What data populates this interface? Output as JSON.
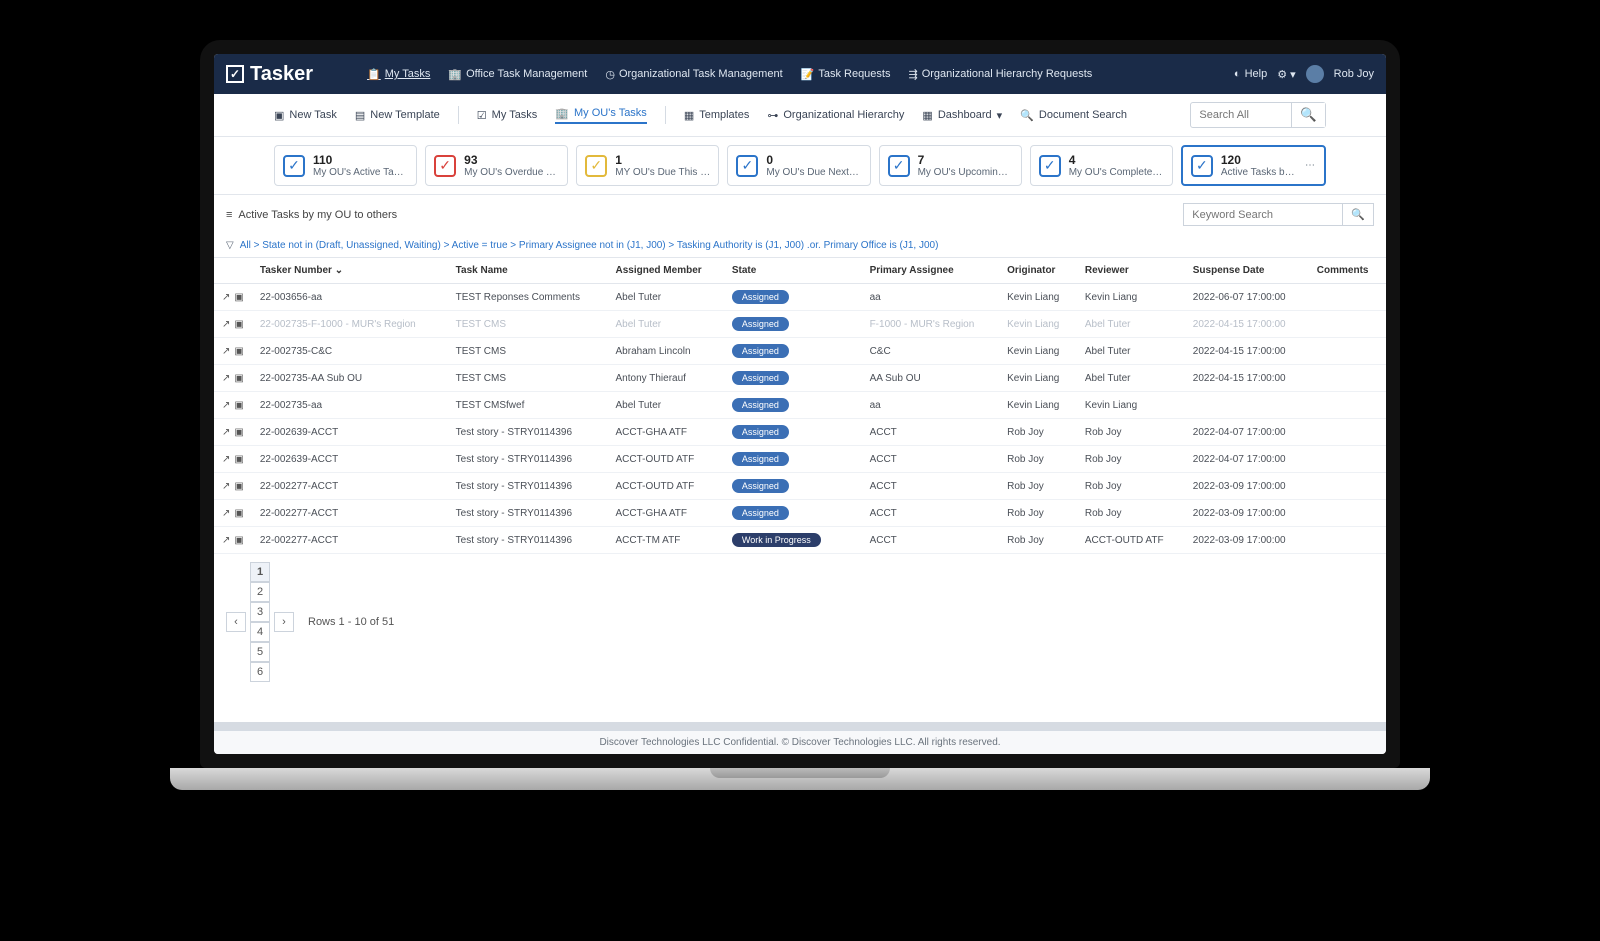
{
  "app": {
    "name": "Tasker",
    "user": "Rob Joy",
    "help_label": "Help"
  },
  "topnav": [
    {
      "label": "My Tasks",
      "active": true
    },
    {
      "label": "Office Task Management"
    },
    {
      "label": "Organizational Task Management"
    },
    {
      "label": "Task Requests"
    },
    {
      "label": "Organizational Hierarchy Requests"
    }
  ],
  "subbar": {
    "new_task": "New Task",
    "new_template": "New Template",
    "my_tasks": "My Tasks",
    "my_ous_tasks": "My OU's Tasks",
    "templates": "Templates",
    "org_hierarchy": "Organizational Hierarchy",
    "dashboard": "Dashboard",
    "doc_search": "Document Search",
    "search_placeholder": "Search All"
  },
  "stats": [
    {
      "num": "110",
      "label": "My OU's Active Tasks",
      "color": "blue"
    },
    {
      "num": "93",
      "label": "My OU's Overdue Tasks",
      "color": "red"
    },
    {
      "num": "1",
      "label": "MY OU's Due This Week",
      "color": "yellow"
    },
    {
      "num": "0",
      "label": "My OU's Due Next Week",
      "color": "blue"
    },
    {
      "num": "7",
      "label": "My OU's Upcoming Tasks",
      "color": "blue"
    },
    {
      "num": "4",
      "label": "My OU's Completed This week",
      "color": "blue"
    },
    {
      "num": "120",
      "label": "Active Tasks by my OU to others",
      "color": "blue",
      "active": true
    }
  ],
  "list": {
    "title": "Active Tasks by my OU to others",
    "filter_text": "All > State not in (Draft, Unassigned, Waiting) > Active = true > Primary Assignee not in (J1, J00) > Tasking Authority is (J1, J00) .or. Primary Office is (J1, J00)",
    "keyword_placeholder": "Keyword Search",
    "columns": [
      "Tasker Number",
      "Task Name",
      "Assigned Member",
      "State",
      "",
      "Primary Assignee",
      "Originator",
      "Reviewer",
      "Suspense Date",
      "Comments"
    ],
    "rows": [
      {
        "num": "22-003656-aa",
        "name": "TEST Reponses Comments",
        "member": "Abel Tuter",
        "state": "Assigned",
        "assignee": "aa",
        "originator": "Kevin Liang",
        "reviewer": "Kevin Liang",
        "date": "2022-06-07 17:00:00"
      },
      {
        "ghost": true,
        "num": "22-002735-F-1000 - MUR's Region",
        "name": "TEST CMS",
        "member": "Abel Tuter",
        "state": "Assigned",
        "assignee": "F-1000 - MUR's Region",
        "originator": "Kevin Liang",
        "reviewer": "Abel Tuter",
        "date": "2022-04-15 17:00:00"
      },
      {
        "num": "22-002735-C&C",
        "name": "TEST CMS",
        "member": "Abraham Lincoln",
        "state": "Assigned",
        "assignee": "C&C",
        "originator": "Kevin Liang",
        "reviewer": "Abel Tuter",
        "date": "2022-04-15 17:00:00"
      },
      {
        "num": "22-002735-AA Sub OU",
        "name": "TEST CMS",
        "member": "Antony Thierauf",
        "state": "Assigned",
        "assignee": "AA Sub OU",
        "originator": "Kevin Liang",
        "reviewer": "Abel Tuter",
        "date": "2022-04-15 17:00:00"
      },
      {
        "num": "22-002735-aa",
        "name": "TEST CMSfwef",
        "member": "Abel Tuter",
        "state": "Assigned",
        "assignee": "aa",
        "originator": "Kevin Liang",
        "reviewer": "Kevin Liang",
        "date": ""
      },
      {
        "num": "22-002639-ACCT",
        "name": "Test story - STRY0114396",
        "member": "ACCT-GHA ATF",
        "state": "Assigned",
        "assignee": "ACCT",
        "originator": "Rob Joy",
        "reviewer": "Rob Joy",
        "date": "2022-04-07 17:00:00"
      },
      {
        "num": "22-002639-ACCT",
        "name": "Test story - STRY0114396",
        "member": "ACCT-OUTD ATF",
        "state": "Assigned",
        "assignee": "ACCT",
        "originator": "Rob Joy",
        "reviewer": "Rob Joy",
        "date": "2022-04-07 17:00:00"
      },
      {
        "num": "22-002277-ACCT",
        "name": "Test story - STRY0114396",
        "member": "ACCT-OUTD ATF",
        "state": "Assigned",
        "assignee": "ACCT",
        "originator": "Rob Joy",
        "reviewer": "Rob Joy",
        "date": "2022-03-09 17:00:00"
      },
      {
        "num": "22-002277-ACCT",
        "name": "Test story - STRY0114396",
        "member": "ACCT-GHA ATF",
        "state": "Assigned",
        "assignee": "ACCT",
        "originator": "Rob Joy",
        "reviewer": "Rob Joy",
        "date": "2022-03-09 17:00:00"
      },
      {
        "num": "22-002277-ACCT",
        "name": "Test story - STRY0114396",
        "member": "ACCT-TM ATF",
        "state": "Work in Progress",
        "wip": true,
        "assignee": "ACCT",
        "originator": "Rob Joy",
        "reviewer": "ACCT-OUTD ATF",
        "date": "2022-03-09 17:00:00"
      }
    ]
  },
  "pager": {
    "pages": [
      "1",
      "2",
      "3",
      "4",
      "5",
      "6"
    ],
    "info": "Rows 1 - 10 of 51"
  },
  "footer": "Discover Technologies LLC Confidential. © Discover Technologies LLC. All rights reserved."
}
